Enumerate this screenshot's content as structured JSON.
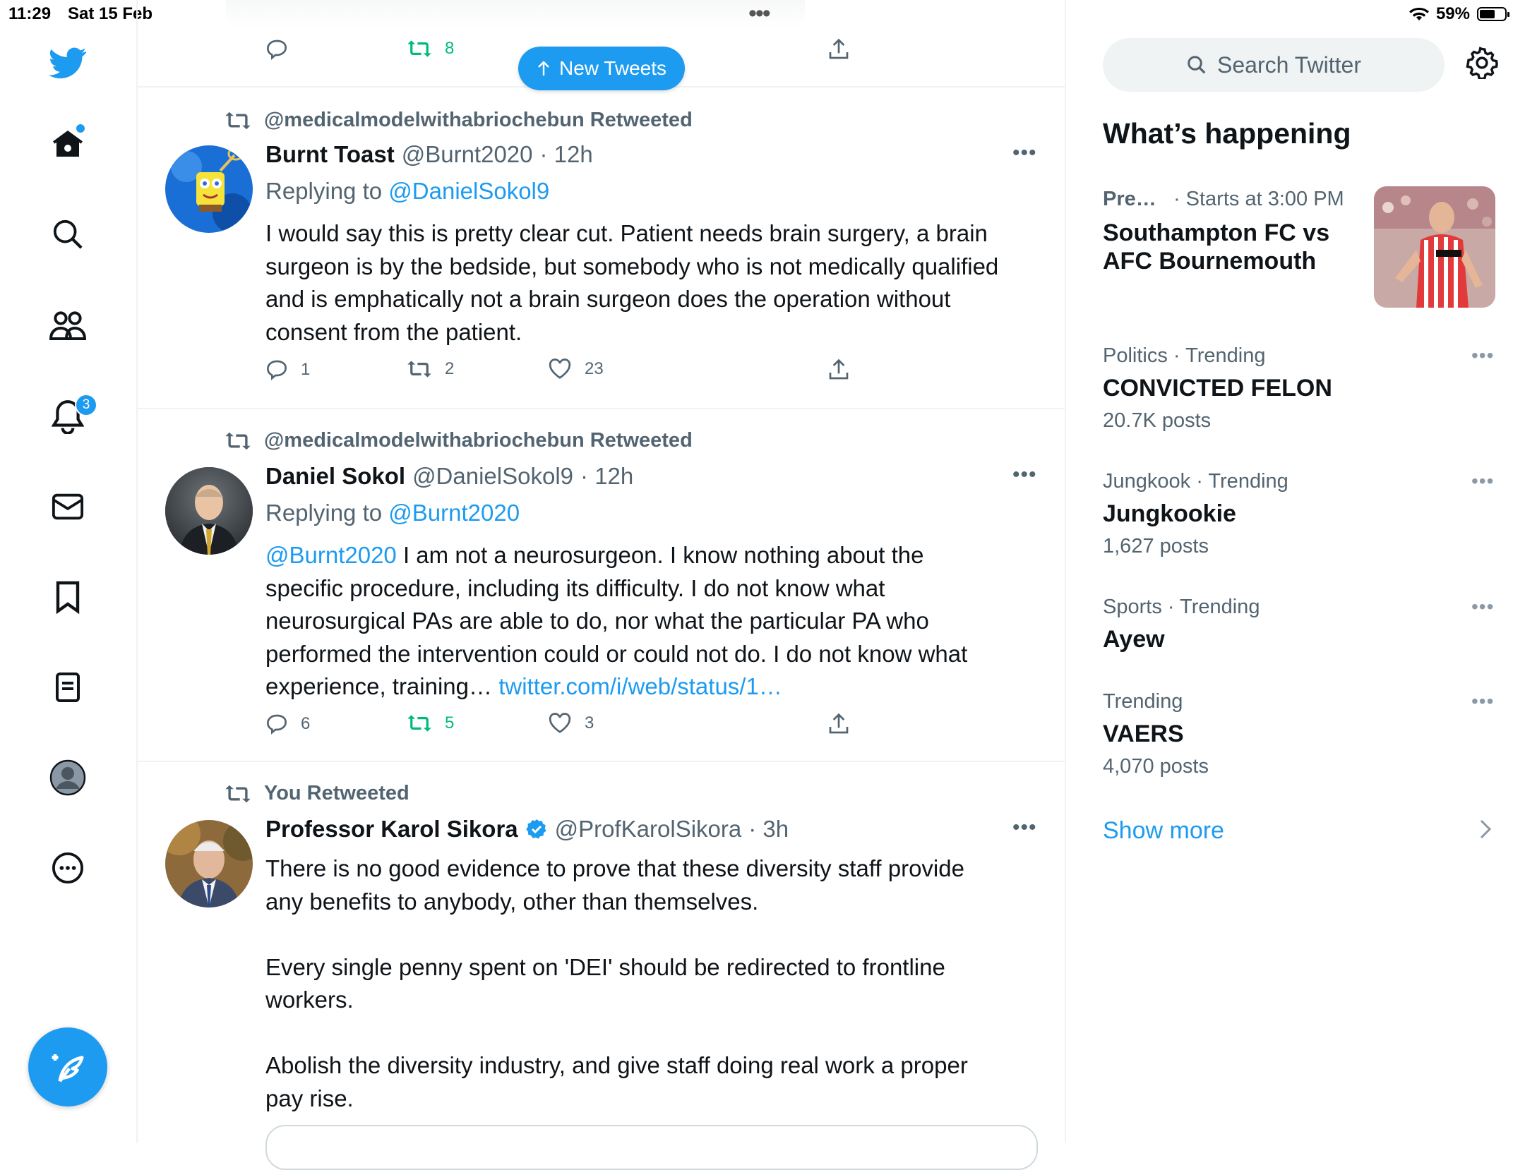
{
  "status_bar": {
    "time": "11:29",
    "date": "Sat 15 Feb",
    "battery": "59%"
  },
  "nav": {
    "notifications_badge": "3"
  },
  "timeline": {
    "top_actions": {
      "retweets": "8"
    },
    "new_tweets_label": "New Tweets",
    "tweets": [
      {
        "retweeted_by": "@medicalmodelwithabriochebun Retweeted",
        "name": "Burnt Toast",
        "handle": "@Burnt2020",
        "time": "· 12h",
        "replying_prefix": "Replying to",
        "replying_to": "@DanielSokol9",
        "text_lines": [
          "I would say this is pretty clear cut. Patient needs brain surgery, a brain",
          "surgeon is by the bedside, but somebody who is not medically qualified",
          "and is emphatically not a brain surgeon does the operation without",
          "consent from the patient."
        ],
        "replies": "1",
        "retweets": "2",
        "likes": "23"
      },
      {
        "retweeted_by": "@medicalmodelwithabriochebun Retweeted",
        "name": "Daniel Sokol",
        "handle": "@DanielSokol9",
        "time": "· 12h",
        "replying_prefix": "Replying to",
        "replying_to": "@Burnt2020",
        "mention": "@Burnt2020",
        "text_first": " I am not a neurosurgeon. I know nothing about the",
        "text_lines": [
          "specific procedure, including its difficulty. I do not know what",
          "neurosurgical PAs are able to do, nor what the particular PA who",
          "performed the intervention could or could not do. I do not know what"
        ],
        "text_last": "experience, training… ",
        "link": "twitter.com/i/web/status/1…",
        "replies": "6",
        "retweets": "5",
        "likes": "3"
      },
      {
        "retweeted_by": "You Retweeted",
        "name": "Professor Karol Sikora",
        "handle": "@ProfKarolSikora",
        "time": "· 3h",
        "text_lines": [
          "There is no good evidence to prove that these diversity staff provide",
          "any benefits to anybody, other than themselves.",
          "",
          "Every single penny spent on 'DEI' should be redirected to frontline",
          "workers.",
          "",
          "Abolish the diversity industry, and give staff doing real work a proper",
          "pay rise."
        ]
      }
    ]
  },
  "sidebar": {
    "search_placeholder": "Search Twitter",
    "whats_happening": "What’s happening",
    "event": {
      "category": "Pre…",
      "time": "· Starts at 3:00 PM",
      "title_line1": "Southampton FC vs",
      "title_line2": "AFC Bournemouth"
    },
    "trends": [
      {
        "meta": "Politics · Trending",
        "title": "CONVICTED FELON",
        "count": "20.7K posts"
      },
      {
        "meta": "Jungkook · Trending",
        "title": "Jungkookie",
        "count": "1,627 posts"
      },
      {
        "meta": "Sports · Trending",
        "title": "Ayew",
        "count": ""
      },
      {
        "meta": "Trending",
        "title": "VAERS",
        "count": "4,070 posts"
      }
    ],
    "show_more": "Show more"
  },
  "colors": {
    "accent": "#1d9bf0",
    "retweet_green": "#00ba7c",
    "muted": "#536471",
    "text": "#0f1419"
  }
}
